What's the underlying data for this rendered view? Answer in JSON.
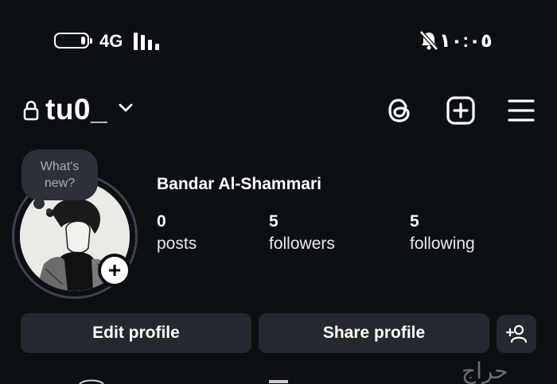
{
  "status_bar": {
    "network": "4G",
    "clock": "١٠:٠٥",
    "battery_level": 0.15
  },
  "header": {
    "username": "tu0_",
    "icons": [
      "lock-icon",
      "chevron-down-icon",
      "threads-icon",
      "create-post-icon",
      "menu-icon"
    ]
  },
  "profile": {
    "note_placeholder": "What's new?",
    "full_name": "Bandar Al-Shammari",
    "stats": [
      {
        "count": "0",
        "label": "posts"
      },
      {
        "count": "5",
        "label": "followers"
      },
      {
        "count": "5",
        "label": "following"
      }
    ]
  },
  "actions": {
    "edit_label": "Edit profile",
    "share_label": "Share profile"
  },
  "watermark": "حراج"
}
